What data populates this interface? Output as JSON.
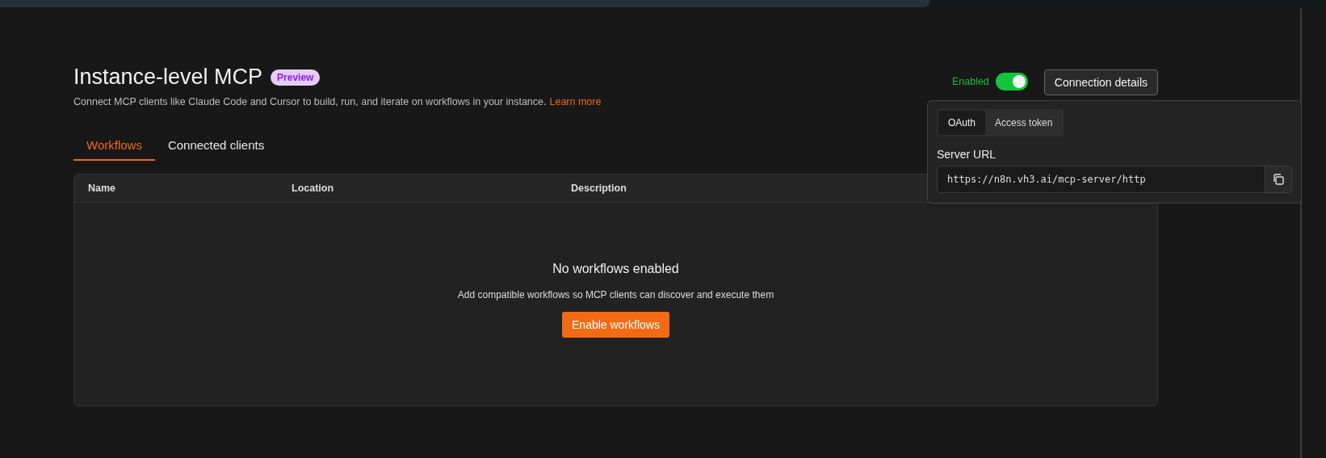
{
  "header": {
    "title": "Instance-level MCP",
    "badge": "Preview",
    "description": "Connect MCP clients like Claude Code and Cursor to build, run, and iterate on workflows in your instance.",
    "link": "Learn more"
  },
  "status": {
    "label": "Enabled",
    "on": true
  },
  "connection_button": "Connection details",
  "popover": {
    "tabs": [
      {
        "label": "OAuth",
        "selected": true
      },
      {
        "label": "Access token",
        "selected": false
      }
    ],
    "field_label": "Server URL",
    "url": "https://n8n.vh3.ai/mcp-server/http"
  },
  "tabs": [
    {
      "label": "Workflows",
      "selected": true
    },
    {
      "label": "Connected clients",
      "selected": false
    }
  ],
  "table": {
    "columns": [
      "Name",
      "Location",
      "Description"
    ],
    "empty": {
      "title": "No workflows enabled",
      "message": "Add compatible workflows so MCP clients can discover and execute them",
      "button": "Enable workflows"
    }
  }
}
